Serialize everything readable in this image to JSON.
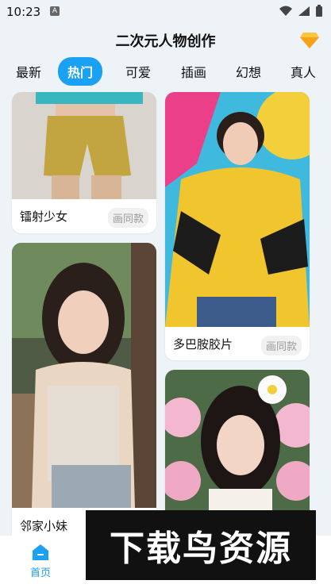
{
  "status": {
    "time": "10:23",
    "notification_icon": "A"
  },
  "header": {
    "title": "二次元人物创作"
  },
  "tabs": [
    "最新",
    "热门",
    "可爱",
    "插画",
    "幻想",
    "真人"
  ],
  "active_tab_index": 1,
  "cards": [
    {
      "title": "镭射少女",
      "tag": "画同款"
    },
    {
      "title": "多巴胺胶片",
      "tag": "画同款"
    },
    {
      "title": "邻家小妹",
      "tag": ""
    },
    {
      "title": "",
      "tag": ""
    }
  ],
  "bottom_nav": {
    "home_label": "首页"
  },
  "banner": {
    "text": "下载鸟资源"
  },
  "colors": {
    "accent": "#1aa1f3",
    "background": "#eef3f7"
  }
}
